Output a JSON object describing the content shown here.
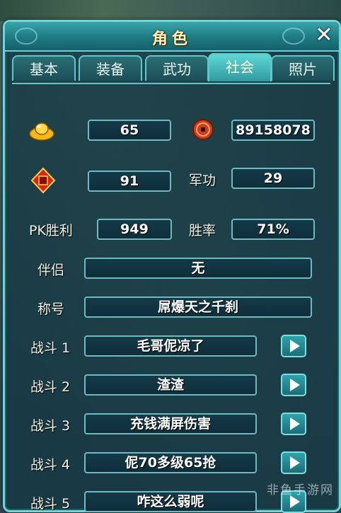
{
  "window": {
    "title": "角色"
  },
  "tabs": [
    {
      "label": "基本",
      "active": false
    },
    {
      "label": "装备",
      "active": false
    },
    {
      "label": "武功",
      "active": false
    },
    {
      "label": "社会",
      "active": true
    },
    {
      "label": "照片",
      "active": false
    }
  ],
  "stats": {
    "gold_icon": "gold-ingot-icon",
    "gold": "65",
    "coin_icon": "copper-coin-icon",
    "coins": "89158078",
    "token_icon": "red-token-icon",
    "token": "91",
    "merit_label": "军功",
    "merit": "29",
    "pk_label": "PK胜利",
    "pk_wins": "949",
    "winrate_label": "胜率",
    "winrate": "71%"
  },
  "social": {
    "partner_label": "伴侣",
    "partner": "无",
    "title_label": "称号",
    "title": "屌爆天之千刹"
  },
  "battle_cries": [
    {
      "label": "战斗 1",
      "text": "毛哥伲凉了"
    },
    {
      "label": "战斗 2",
      "text": "渣渣"
    },
    {
      "label": "战斗 3",
      "text": "充钱满屏伤害"
    },
    {
      "label": "战斗 4",
      "text": "伲70多级65抢"
    },
    {
      "label": "战斗 5",
      "text": "咋这么弱呢"
    }
  ],
  "watermark": "非鱼手游网",
  "colors": {
    "accent": "#6fd6d8",
    "title_text": "#fff2c0",
    "field_border": "#6fb9c0"
  }
}
